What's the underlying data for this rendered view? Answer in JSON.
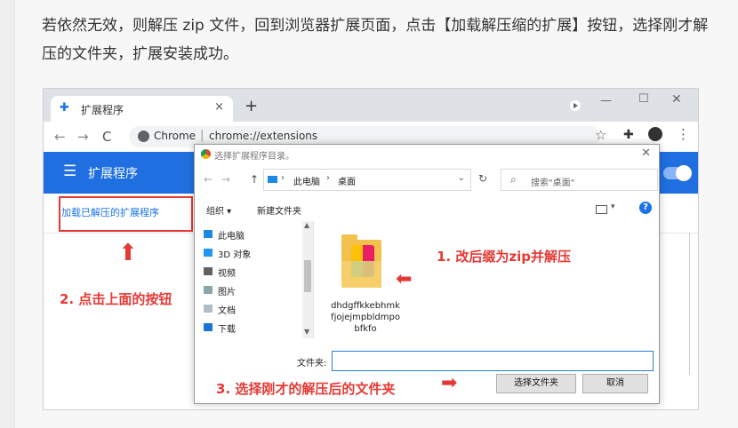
{
  "article": {
    "intro": "若依然无效，则解压 zip 文件，回到浏览器扩展页面，点击【加载解压缩的扩展】按钮，选择刚才解压的文件夹，扩展安装成功。"
  },
  "browser": {
    "tab_title": "扩展程序",
    "tab_close": "×",
    "new_tab": "+",
    "nav_back": "←",
    "nav_forward": "→",
    "nav_reload": "C",
    "omnibox_site": "Chrome",
    "omnibox_sep": "|",
    "omnibox_url": "chrome://extensions",
    "star": "☆",
    "puzzle": "✚",
    "menu": "⋮",
    "win_min": "—",
    "win_max": "☐",
    "win_close": "✕"
  },
  "extensions_page": {
    "hamburger": "☰",
    "title": "扩展程序",
    "load_unpacked_label": "加载已解压的扩展程序",
    "accent_color": "#1f6fe0"
  },
  "dialog": {
    "title": "选择扩展程序目录。",
    "close": "✕",
    "back": "←",
    "forward": "→",
    "up": "↑",
    "breadcrumb_sep": "›",
    "breadcrumb": [
      "此电脑",
      "桌面"
    ],
    "addr_dropdown": "⌄",
    "refresh": "↻",
    "search_placeholder": "搜索\"桌面\"",
    "search_icon": "⌕",
    "organize": "组织 ▾",
    "new_folder": "新建文件夹",
    "view_dropdown": "▾",
    "help": "?",
    "nav_items": [
      {
        "label": "此电脑",
        "icon": "computer-icon"
      },
      {
        "label": "3D 对象",
        "icon": "cube-icon"
      },
      {
        "label": "视频",
        "icon": "video-icon"
      },
      {
        "label": "图片",
        "icon": "picture-icon"
      },
      {
        "label": "文档",
        "icon": "document-icon"
      },
      {
        "label": "下载",
        "icon": "download-icon"
      }
    ],
    "scroll_up": "▲",
    "scroll_down": "▼",
    "file_name": "dhdgffkkebhmkfjojejmpbldmpobfkfo",
    "folder_label": "文件夹:",
    "folder_value": "",
    "select_button": "选择文件夹",
    "cancel_button": "取消"
  },
  "annotations": {
    "step1": "1. 改后缀为zip并解压",
    "step2": "2. 点击上面的按钮",
    "step3": "3. 选择刚才的解压后的文件夹",
    "arrow_up": "⬆",
    "arrow_left": "⬅",
    "arrow_right": "➡",
    "color": "#e53935"
  }
}
